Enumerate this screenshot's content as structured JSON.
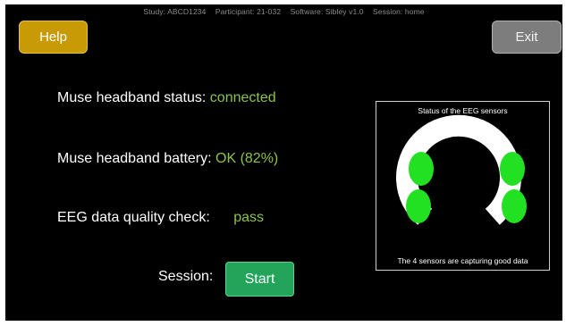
{
  "header": {
    "study": "Study: ABCD1234",
    "participant": "Participant: 21-032",
    "software": "Software: Sibley v1.0",
    "session": "Session: home"
  },
  "buttons": {
    "help": "Help",
    "exit": "Exit",
    "start": "Start"
  },
  "status": {
    "headband_status_label": "Muse headband status:",
    "headband_status_value": "connected",
    "battery_label": "Muse headband battery:",
    "battery_value": "OK (82%)",
    "quality_label": "EEG data quality check:",
    "quality_value": "pass",
    "session_label": "Session:"
  },
  "sensor_panel": {
    "title": "Status of the EEG sensors",
    "caption": "The 4 sensors are capturing good data",
    "sensors": [
      {
        "name": "left-upper",
        "status": "good"
      },
      {
        "name": "left-lower",
        "status": "good"
      },
      {
        "name": "right-upper",
        "status": "good"
      },
      {
        "name": "right-lower",
        "status": "good"
      }
    ],
    "good_color": "#22e022"
  },
  "colors": {
    "background": "#000000",
    "value_text": "#8bc34a",
    "help": "#c79a06",
    "exit": "#7d7d7d",
    "start": "#22a55a"
  }
}
